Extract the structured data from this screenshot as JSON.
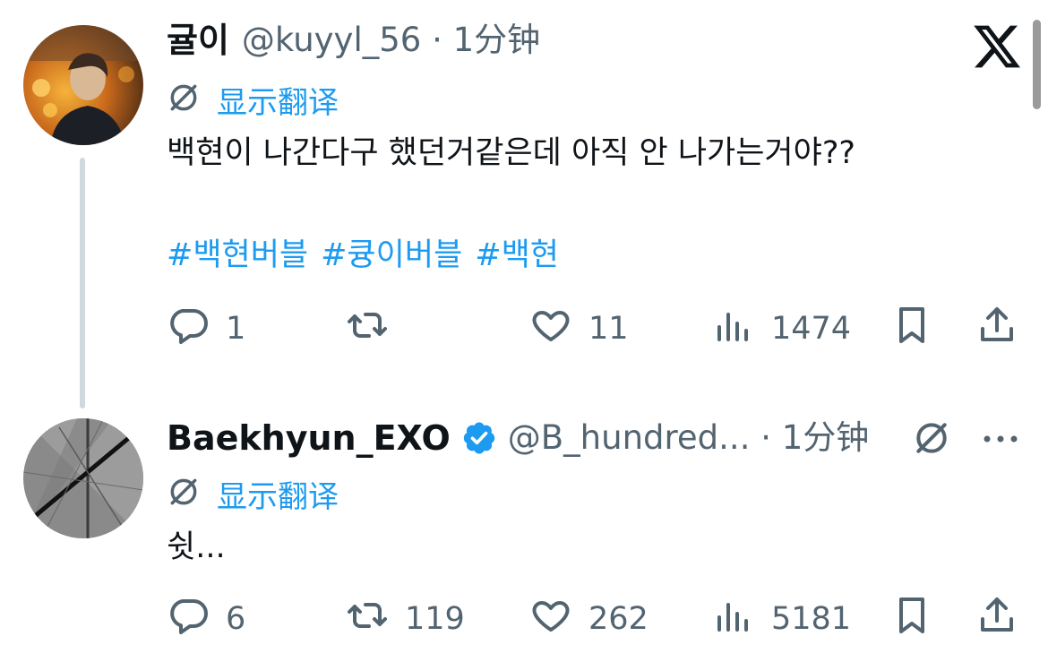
{
  "colors": {
    "accent": "#1d9bf0",
    "secondary_text": "#536471",
    "primary_text": "#0f1419",
    "thread_line": "#cfd9de"
  },
  "tweets": [
    {
      "display_name": "귤이",
      "handle_time": "@kuyyl_56 · 1分钟",
      "translate_label": "显示翻译",
      "text": "백현이 나간다구 했던거같은데 아직 안 나가는거야??",
      "hashtags": [
        "#백현버블",
        "#큥이버블",
        "#백현"
      ],
      "actions": {
        "replies": "1",
        "reposts": "",
        "likes": "11",
        "views": "1474"
      }
    },
    {
      "display_name": "Baekhyun_EXO",
      "handle_time": "@B_hundred... · 1分钟",
      "translate_label": "显示翻译",
      "text": "쉿...",
      "verified": true,
      "actions": {
        "replies": "6",
        "reposts": "119",
        "likes": "262",
        "views": "5181"
      }
    }
  ],
  "icons": {
    "close": "x-logo-icon",
    "translate": "translate-icon",
    "reply": "reply-icon",
    "repost": "repost-icon",
    "like": "heart-icon",
    "views": "views-icon",
    "bookmark": "bookmark-icon",
    "share": "share-icon",
    "more": "more-icon",
    "grok": "grok-icon"
  }
}
